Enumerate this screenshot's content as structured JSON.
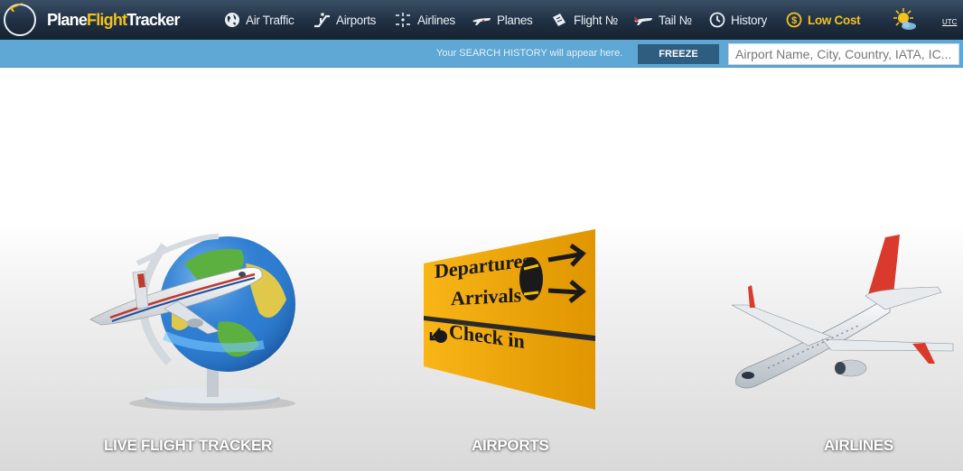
{
  "brand": {
    "part1": "Plane",
    "part2": "Flight",
    "part3": "Tracker"
  },
  "nav": [
    {
      "label": "Air Traffic",
      "icon": "globe-icon"
    },
    {
      "label": "Airports",
      "icon": "escalator-icon"
    },
    {
      "label": "Airlines",
      "icon": "route-icon"
    },
    {
      "label": "Planes",
      "icon": "plane-icon"
    },
    {
      "label": "Flight №",
      "icon": "ticket-icon"
    },
    {
      "label": "Tail №",
      "icon": "plane-tail-icon"
    },
    {
      "label": "History",
      "icon": "clock-icon"
    },
    {
      "label": "Low Cost",
      "icon": "dollar-icon"
    }
  ],
  "utc_label": "UTC",
  "search_bar": {
    "hint": "Your SEARCH HISTORY will appear here.",
    "freeze_label": "FREEZE",
    "placeholder": "Airport Name, City, Country, IATA, IC...",
    "value": ""
  },
  "cards": [
    {
      "label": "LIVE FLIGHT TRACKER"
    },
    {
      "label": "AIRPORTS"
    },
    {
      "label": "AIRLINES"
    }
  ],
  "sign": {
    "line1": "Departures",
    "line2": "Arrivals",
    "line3": "Check in"
  },
  "colors": {
    "accent": "#f3c21d",
    "nav_bg": "#1f2f42",
    "strip_bg": "#5fa7d4",
    "freeze_bg": "#2f5d80",
    "sign_bg": "#f5a800"
  }
}
